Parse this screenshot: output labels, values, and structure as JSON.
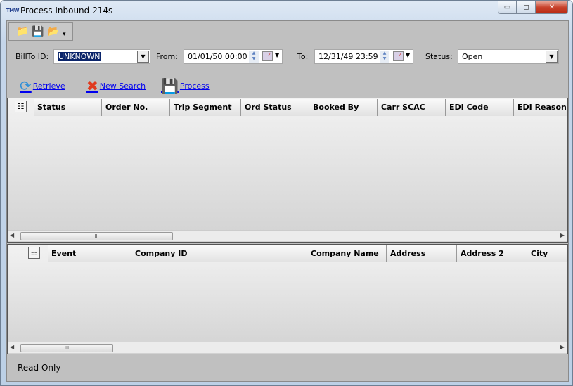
{
  "window": {
    "title": "Process Inbound 214s",
    "logo": "TMW",
    "minimize": "▭",
    "maximize": "◻",
    "close": "✕"
  },
  "toolbar": {
    "items": [
      {
        "icon": "new-folder-icon",
        "glyph": "📁"
      },
      {
        "icon": "save-icon",
        "glyph": "💾"
      },
      {
        "icon": "open-folder-icon",
        "glyph": "📂"
      }
    ],
    "overflow": "▾"
  },
  "filters": {
    "billto_label": "BillTo ID:",
    "billto_value": "UNKNOWN",
    "from_label": "From:",
    "from_value": "01/01/50 00:00",
    "to_label": "To:",
    "to_value": "12/31/49 23:59",
    "status_label": "Status:",
    "status_value": "Open"
  },
  "actions": {
    "retrieve": "Retrieve",
    "new_search": "New Search",
    "process": "Process"
  },
  "grid1": {
    "columns": [
      "Status",
      "Order No.",
      "Trip Segment",
      "Ord Status",
      "Booked By",
      "Carr SCAC",
      "EDI Code",
      "EDI Reasoncode"
    ]
  },
  "grid2": {
    "columns": [
      "Event",
      "Company ID",
      "Company Name",
      "Address",
      "Address 2",
      "City"
    ]
  },
  "statusbar": {
    "text": "Read Only"
  }
}
